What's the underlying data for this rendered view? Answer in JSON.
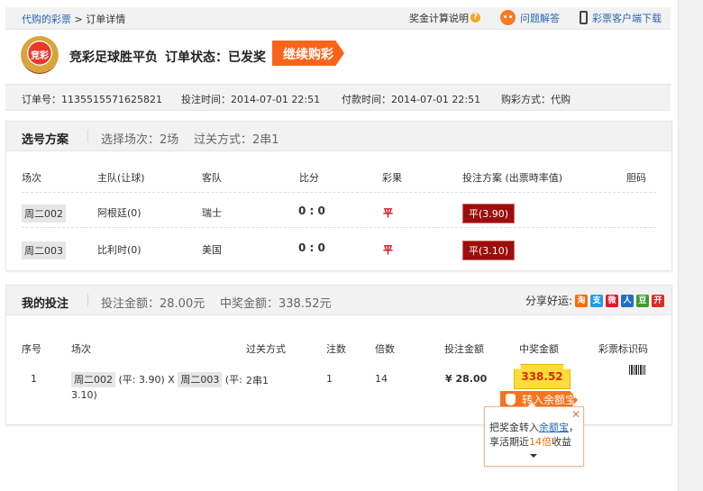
{
  "breadcrumb": {
    "link": "代购的彩票",
    "sep": " > ",
    "current": "订单详情"
  },
  "top_links": {
    "prize_rules": "奖金计算说明",
    "qa": "问题解答",
    "client": "彩票客户端下载"
  },
  "header": {
    "logo_text": "竞彩",
    "lottery_name": "竞彩足球胜平负",
    "status_label": "订单状态：",
    "status_value": "已发奖",
    "continue_button": "继续购彩"
  },
  "order_info": {
    "order_no": "订单号：1135515571625821",
    "bet_time": "投注时间：2014-07-01 22:51",
    "pay_time": "付款时间：2014-07-01 22:51",
    "buy_method": "购彩方式：代购"
  },
  "selection": {
    "title": "选号方案",
    "matches_count": "选择场次：2场",
    "pass_type": "过关方式：2串1",
    "columns": [
      "场次",
      "主队(让球)",
      "客队",
      "比分",
      "彩果",
      "投注方案 (出票時率值)",
      "胆码"
    ],
    "rows": [
      {
        "match": "周二002",
        "home": "阿根廷(0)",
        "away": "瑞士",
        "score": "0 : 0",
        "result": "平",
        "pick": "平(3.90)",
        "banker": ""
      },
      {
        "match": "周二003",
        "home": "比利时(0)",
        "away": "美国",
        "score": "0 : 0",
        "result": "平",
        "pick": "平(3.10)",
        "banker": ""
      }
    ]
  },
  "my_bet": {
    "title": "我的投注",
    "bet_amount": "投注金额：28.00元",
    "win_amount": "中奖金额：338.52元",
    "share_label": "分享好运:",
    "share_icons": [
      {
        "icon": "taobao-icon",
        "glyph": "淘",
        "color": "#ff6a00"
      },
      {
        "icon": "alipay-icon",
        "glyph": "支",
        "color": "#1ea0e6"
      },
      {
        "icon": "weibo-icon",
        "glyph": "微",
        "color": "#e6162d"
      },
      {
        "icon": "renren-icon",
        "glyph": "人",
        "color": "#1f6fc5"
      },
      {
        "icon": "douban-icon",
        "glyph": "豆",
        "color": "#3e9b2e"
      },
      {
        "icon": "kaixin-icon",
        "glyph": "开",
        "color": "#e02a2a"
      }
    ],
    "columns": [
      "序号",
      "场次",
      "过关方式",
      "注数",
      "倍数",
      "投注金额",
      "中奖金额",
      "彩票标识码"
    ],
    "row": {
      "index": "1",
      "match1": "周二002",
      "pick1": "(平: 3.90)",
      "x": "X",
      "match2": "周二003",
      "pick2_a": "(平:",
      "pick2_b": "3.10)",
      "pass_type": "2串1",
      "bets": "1",
      "multiple": "14",
      "amount": "¥ 28.00",
      "prize": "338.52",
      "transfer_button": "转入余额宝"
    }
  },
  "tooltip": {
    "line1_pre": "把奖金转入",
    "line1_link": "余额宝",
    "line1_post": "，",
    "line2_pre": "享活期近",
    "line2_hl": "14倍",
    "line2_post": "收益"
  }
}
